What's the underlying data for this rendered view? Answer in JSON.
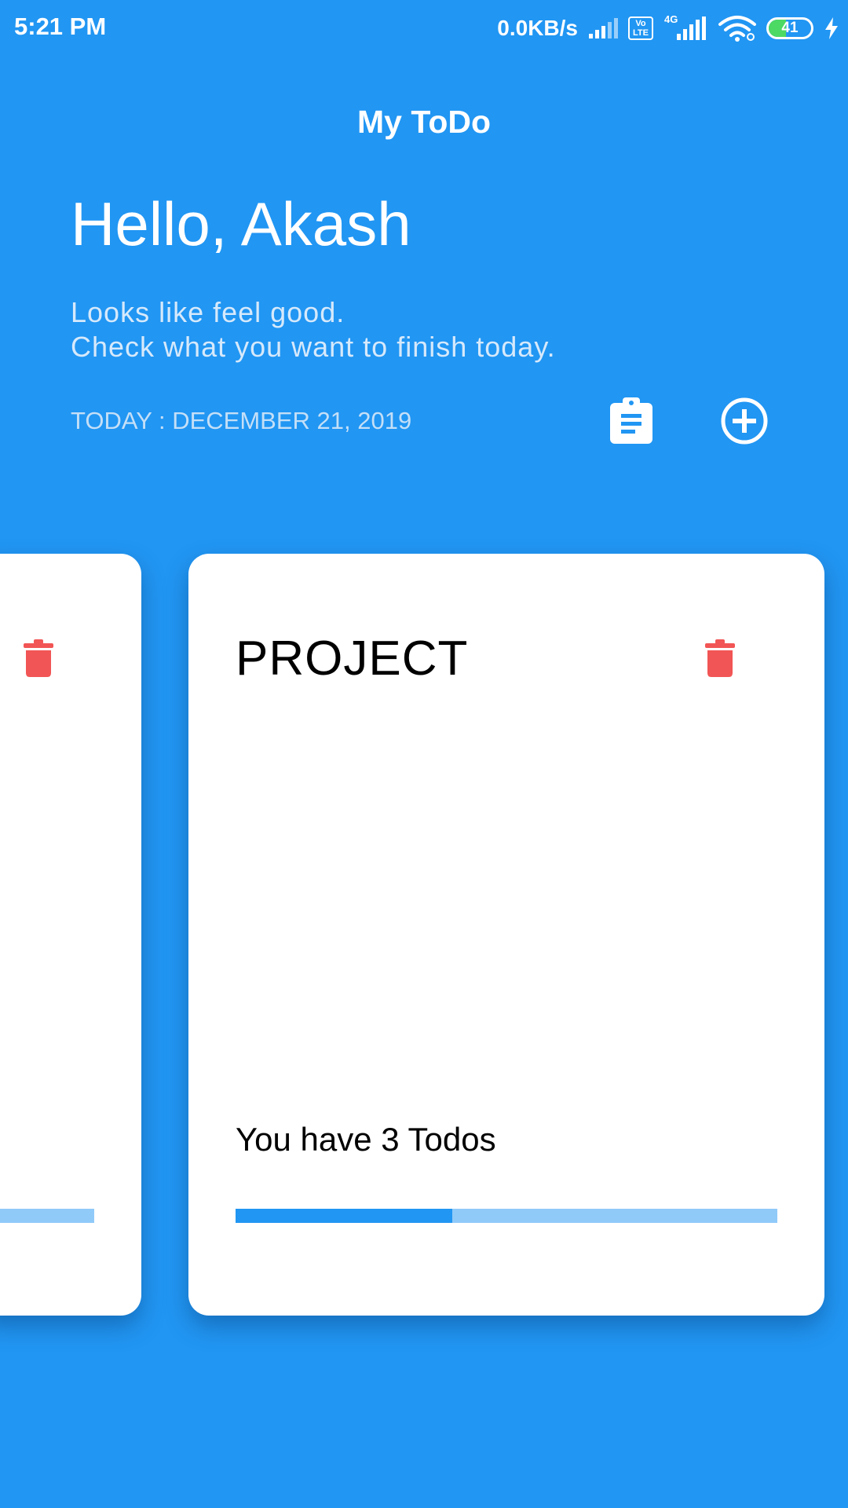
{
  "status_bar": {
    "time": "5:21 PM",
    "network_speed": "0.0KB/s",
    "volte_label_top": "Vo",
    "volte_label_bottom": "LTE",
    "network_type": "4G",
    "battery_level": "41",
    "battery_fraction": 0.41,
    "icons": [
      "signal-icon",
      "volte-icon",
      "signal-4g-icon",
      "wifi-icon",
      "battery-icon",
      "charging-icon"
    ]
  },
  "header": {
    "app_title": "My ToDo",
    "greeting": "Hello, Akash",
    "subtitle_line1": "Looks like feel good.",
    "subtitle_line2": "Check what you want to finish today.",
    "today": "TODAY : DECEMBER 21, 2019",
    "actions": [
      {
        "icon": "clipboard-icon"
      },
      {
        "icon": "add-circle-icon"
      }
    ]
  },
  "cards": [
    {
      "title": "",
      "todo_count_text": "",
      "progress_fraction": 0,
      "delete_icon": "trash-icon"
    },
    {
      "title": "PROJECT",
      "todo_count_text": "You have 3 Todos",
      "progress_fraction": 0.4,
      "delete_icon": "trash-icon"
    }
  ],
  "colors": {
    "background": "#2196F3",
    "card": "#FFFFFF",
    "delete": "#F25555",
    "progress_fill": "#2196F3",
    "progress_track": "#90CAF9",
    "battery_fill": "#4CD964"
  }
}
